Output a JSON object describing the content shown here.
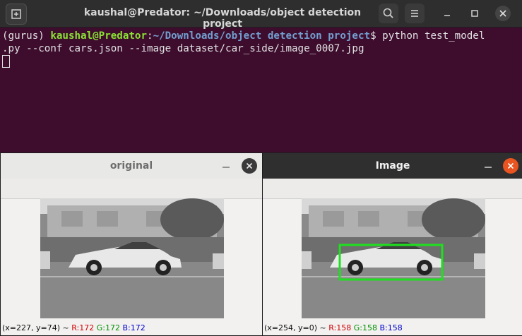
{
  "terminal": {
    "title": "kaushal@Predator: ~/Downloads/object detection project",
    "prompt_env": "(gurus) ",
    "prompt_user": "kaushal@Predator",
    "prompt_sep": ":",
    "prompt_path": "~/Downloads/object detection project",
    "prompt_dollar": "$ ",
    "command_line1": "python test_model",
    "command_line2": ".py --conf cars.json --image dataset/car_side/image_0007.jpg"
  },
  "window_original": {
    "title": "original",
    "status_prefix": "(x=227, y=74) ~ ",
    "r": "R:172",
    "g": "G:172",
    "b": "B:172"
  },
  "window_image": {
    "title": "Image",
    "status_prefix": "(x=254, y=0) ~ ",
    "r": "R:158",
    "g": "G:158",
    "b": "B:158"
  },
  "colors": {
    "terminal_bg": "#3e0d2e",
    "prompt_user": "#8ae234",
    "prompt_path": "#729fcf",
    "detection_box": "#1ee01e",
    "close_active": "#e95420"
  },
  "icons": [
    "new-tab-icon",
    "search-icon",
    "hamburger-menu-icon",
    "minimize-icon",
    "maximize-icon",
    "close-icon"
  ]
}
